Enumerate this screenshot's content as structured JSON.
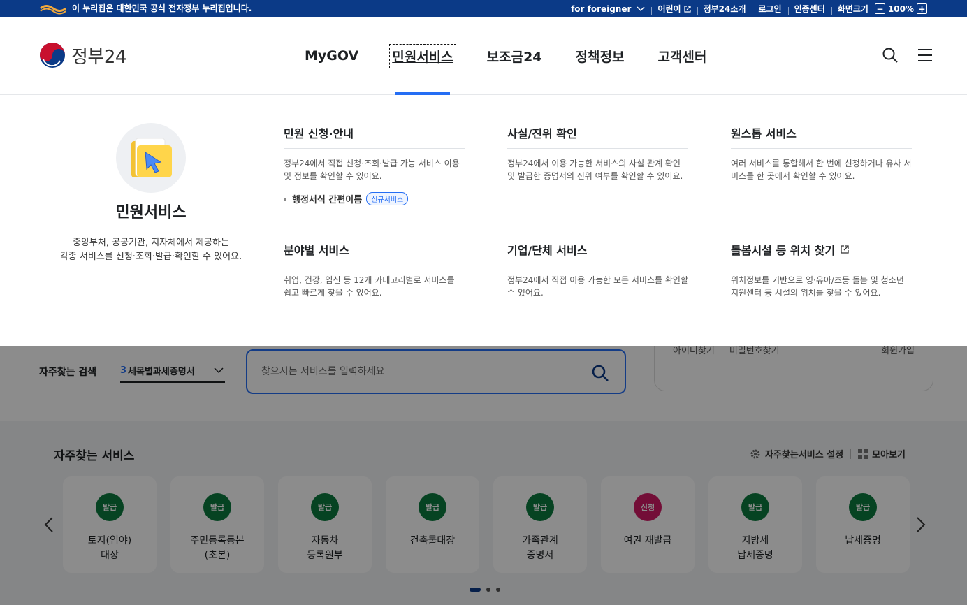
{
  "topbar": {
    "notice": "이 누리집은 대한민국 공식 전자정부 누리집입니다.",
    "foreigner": "for foreigner",
    "kids": "어린이",
    "intro": "정부24소개",
    "login": "로그인",
    "cert": "인증센터",
    "screen_size": "화면크기",
    "zoom": "100%"
  },
  "logo": {
    "text": "정부24"
  },
  "gnb": [
    "MyGOV",
    "민원서비스",
    "보조금24",
    "정책정보",
    "고객센터"
  ],
  "mega": {
    "intro_title": "민원서비스",
    "intro_desc": "중앙부처, 공공기관, 지자체에서 제공하는\n각종 서비스를 신청·조회·발급·확인할 수 있어요.",
    "cols": [
      {
        "title": "민원 신청·안내",
        "desc": "정부24에서 직접 신청·조회·발급 가능 서비스 이용 및 정보를 확인할 수 있어요.",
        "sub": "행정서식 간편이름",
        "badge": "신규서비스"
      },
      {
        "title": "사실/진위 확인",
        "desc": "정부24에서 이용 가능한 서비스의 사실 관계 확인 및 발급한 증명서의 진위 여부를 확인할 수 있어요."
      },
      {
        "title": "원스톱 서비스",
        "desc": "여러 서비스를 통합해서 한 번에 신청하거나 유사 서비스를 한 곳에서 확인할 수 있어요."
      },
      {
        "title": "분야별 서비스",
        "desc": "취업, 건강, 임신 등 12개 카테고리별로 서비스를 쉽고 빠르게 찾을 수 있어요."
      },
      {
        "title": "기업/단체 서비스",
        "desc": "정부24에서 직접 이용 가능한 모든 서비스를 확인할 수 있어요."
      },
      {
        "title": "돌봄시설 등 위치 찾기",
        "desc": "위치정보를 기반으로 영·유아/초등 돌봄 및 청소년 지원센터 등 시설의 위치를 찾을 수 있어요."
      }
    ]
  },
  "login_card": {
    "find_id": "아이디찾기",
    "find_pw": "비밀번호찾기",
    "join": "회원가입"
  },
  "search": {
    "fav_label": "자주찾는 검색",
    "select_num": "3",
    "select_value": "세목별과세증명서",
    "placeholder": "찾으시는 서비스를 입력하세요"
  },
  "fav": {
    "title": "자주찾는 서비스",
    "settings": "자주찾는서비스 설정",
    "view_all": "모아보기",
    "cards": [
      {
        "badge": "발급",
        "name": "토지(임야)\n대장",
        "color": "#0b7a3e"
      },
      {
        "badge": "발급",
        "name": "주민등록등본\n(초본)",
        "color": "#0b7a3e"
      },
      {
        "badge": "발급",
        "name": "자동차\n등록원부",
        "color": "#0b7a3e"
      },
      {
        "badge": "발급",
        "name": "건축물대장",
        "color": "#0b7a3e"
      },
      {
        "badge": "발급",
        "name": "가족관계\n증명서",
        "color": "#0b7a3e"
      },
      {
        "badge": "신청",
        "name": "여권 재발급",
        "color": "#d11b64"
      },
      {
        "badge": "발급",
        "name": "지방세\n납세증명",
        "color": "#0b7a3e"
      },
      {
        "badge": "발급",
        "name": "납세증명",
        "color": "#0b7a3e"
      }
    ]
  }
}
